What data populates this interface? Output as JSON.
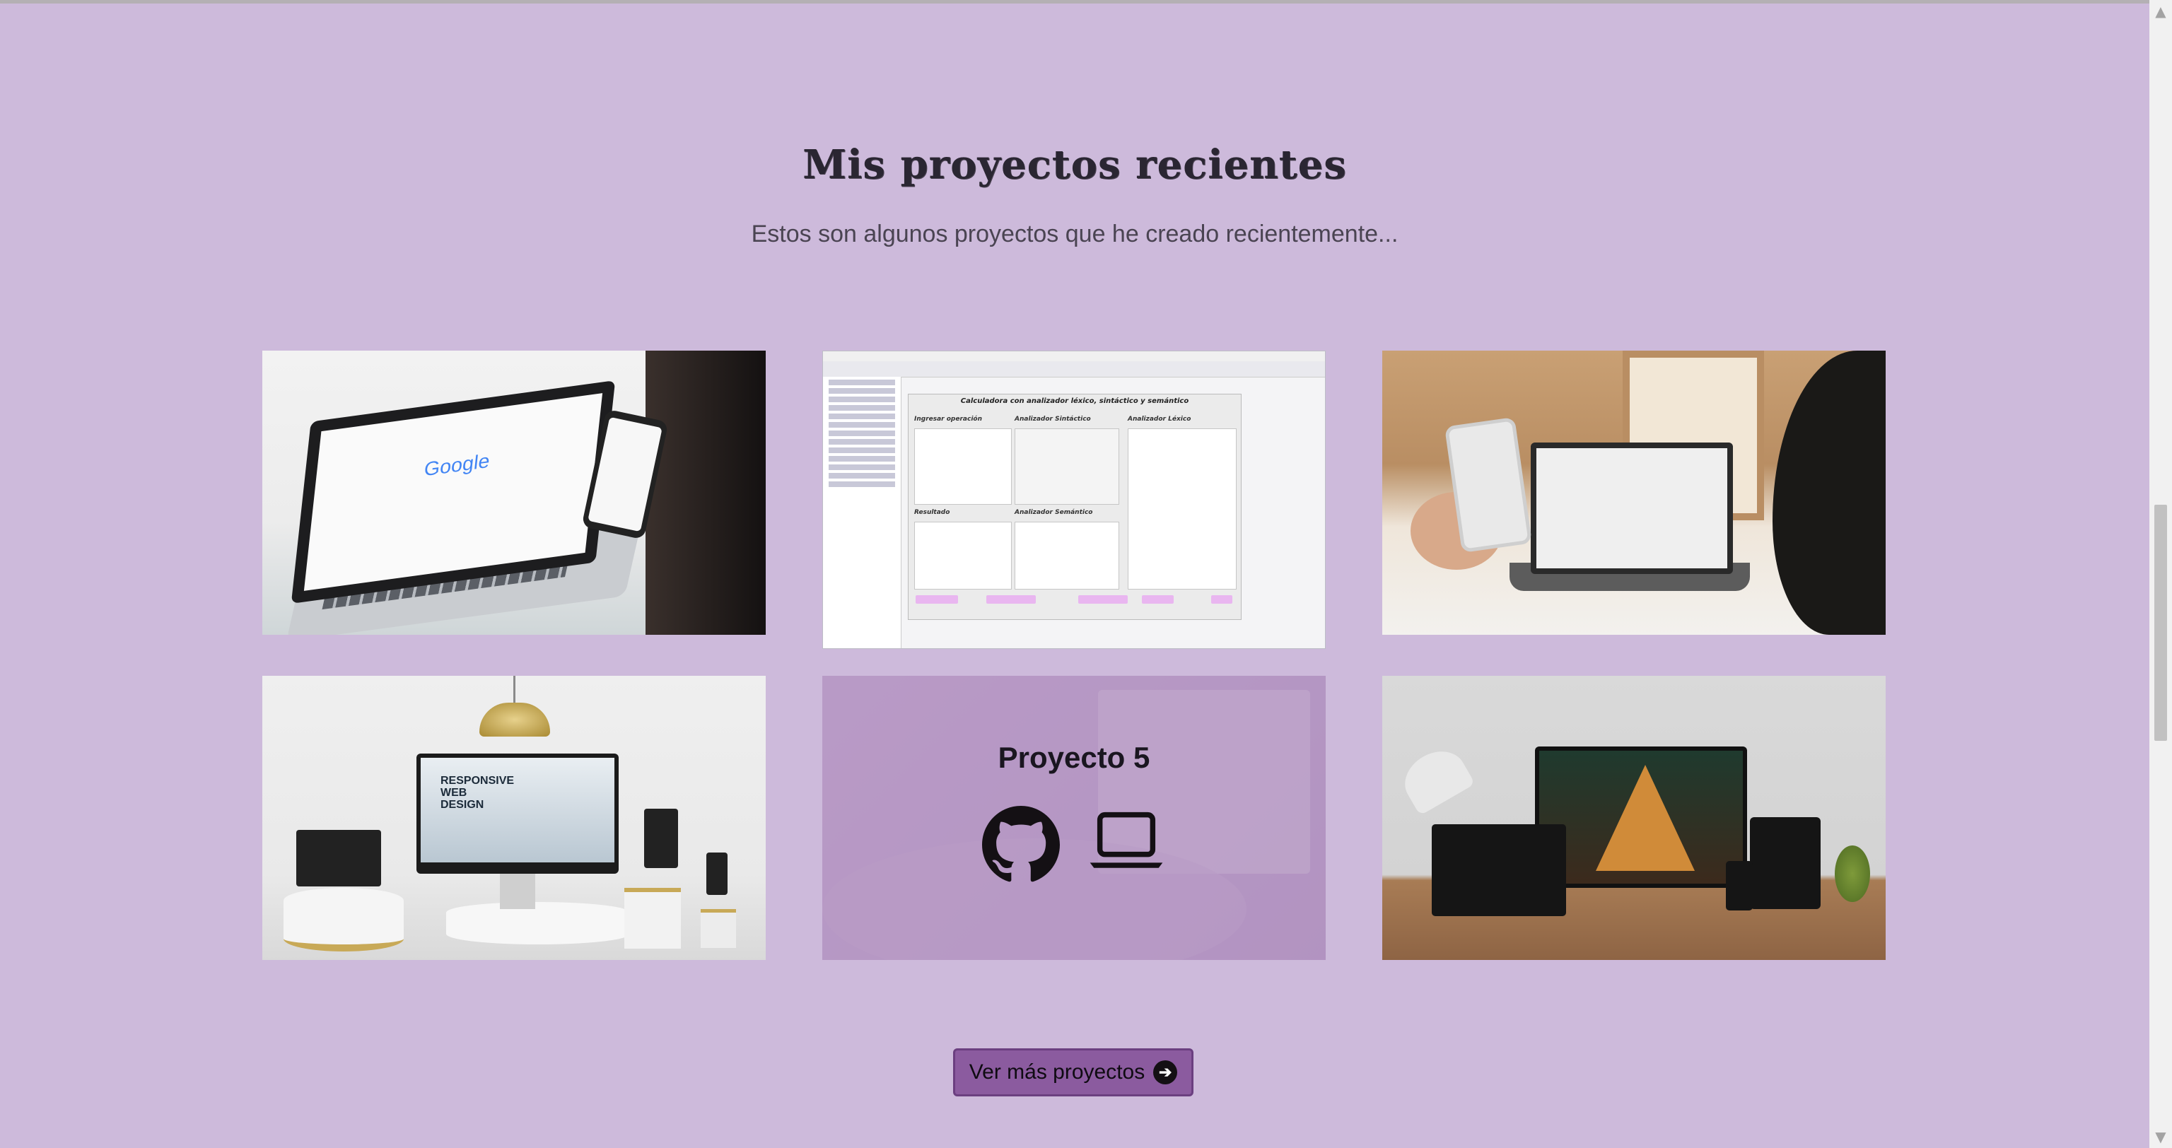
{
  "section": {
    "title": "Mis proyectos recientes",
    "subtitle": "Estos son algunos proyectos que he creado recientemente..."
  },
  "projects": [
    {
      "image": "laptop-and-phone-with-google-photo"
    },
    {
      "image": "ide-calculator-screenshot",
      "ide": {
        "form_title": "Calculadora con analizador léxico, sintáctico y semántico",
        "labels": [
          "Ingresar operación",
          "Analizador Sintáctico",
          "Analizador Léxico",
          "Resultado",
          "Analizador Semántico"
        ]
      }
    },
    {
      "image": "person-with-phone-and-laptop-photo"
    },
    {
      "image": "responsive-web-design-devices-photo",
      "screen_text": "RESPONSIVE WEB DESIGN"
    },
    {
      "image": "laptop-on-table-photo",
      "hover_title": "Proyecto 5",
      "icons": [
        "github-icon",
        "laptop-icon"
      ]
    },
    {
      "image": "architect-studio-devices-photo"
    }
  ],
  "cta": {
    "label": "Ver más proyectos",
    "icon": "arrow-right-circle-icon"
  },
  "colors": {
    "background": "#cdbadb",
    "button": "#8b5b9f",
    "button_border": "#6b3f80"
  }
}
